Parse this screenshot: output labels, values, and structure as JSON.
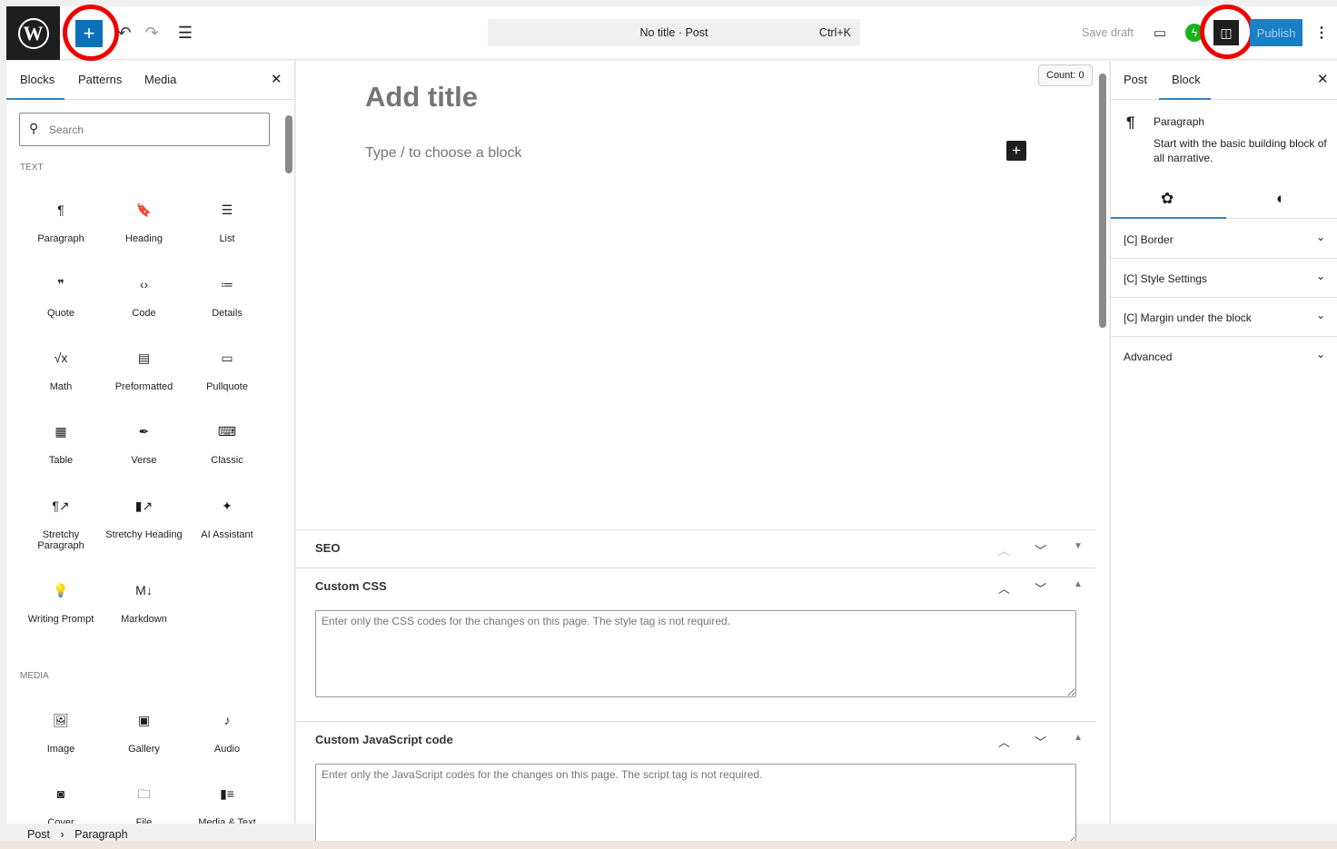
{
  "topbar": {
    "title": "No title · Post",
    "shortcut": "Ctrl+K",
    "save_draft": "Save draft",
    "publish": "Publish"
  },
  "left_panel": {
    "tabs": [
      "Blocks",
      "Patterns",
      "Media"
    ],
    "search_placeholder": "Search",
    "section_text": "TEXT",
    "section_media": "MEDIA",
    "text_blocks": [
      {
        "icon": "¶",
        "label": "Paragraph"
      },
      {
        "icon": "🔖",
        "label": "Heading"
      },
      {
        "icon": "☰",
        "label": "List"
      },
      {
        "icon": "❞",
        "label": "Quote"
      },
      {
        "icon": "‹›",
        "label": "Code"
      },
      {
        "icon": "≔",
        "label": "Details"
      },
      {
        "icon": "√x",
        "label": "Math"
      },
      {
        "icon": "▤",
        "label": "Preformatted"
      },
      {
        "icon": "▭",
        "label": "Pullquote"
      },
      {
        "icon": "▦",
        "label": "Table"
      },
      {
        "icon": "✒",
        "label": "Verse"
      },
      {
        "icon": "⌨",
        "label": "Classic"
      },
      {
        "icon": "¶↗",
        "label": "Stretchy Paragraph"
      },
      {
        "icon": "▮↗",
        "label": "Stretchy Heading"
      },
      {
        "icon": "✦",
        "label": "AI Assistant"
      },
      {
        "icon": "💡",
        "label": "Writing Prompt"
      },
      {
        "icon": "M↓",
        "label": "Markdown"
      }
    ],
    "media_blocks": [
      {
        "icon": "🖼",
        "label": "Image"
      },
      {
        "icon": "▣",
        "label": "Gallery"
      },
      {
        "icon": "♪",
        "label": "Audio"
      },
      {
        "icon": "◙",
        "label": "Cover"
      },
      {
        "icon": "🗀",
        "label": "File"
      },
      {
        "icon": "▮≡",
        "label": "Media & Text"
      }
    ]
  },
  "editor": {
    "title_placeholder": "Add title",
    "block_placeholder": "Type / to choose a block",
    "count": "Count: 0",
    "meta_boxes": [
      {
        "title": "SEO"
      },
      {
        "title": "Custom CSS",
        "placeholder": "Enter only the CSS codes for the changes on this page. The style tag is not required."
      },
      {
        "title": "Custom JavaScript code",
        "placeholder": "Enter only the JavaScript codes for the changes on this page. The script tag is not required."
      }
    ]
  },
  "right_panel": {
    "tabs": [
      "Post",
      "Block"
    ],
    "block_name": "Paragraph",
    "block_desc": "Start with the basic building block of all narrative.",
    "panels": [
      "[C] Border",
      "[C] Style Settings",
      "[C] Margin under the block",
      "Advanced"
    ]
  },
  "breadcrumb": [
    "Post",
    "Paragraph"
  ]
}
